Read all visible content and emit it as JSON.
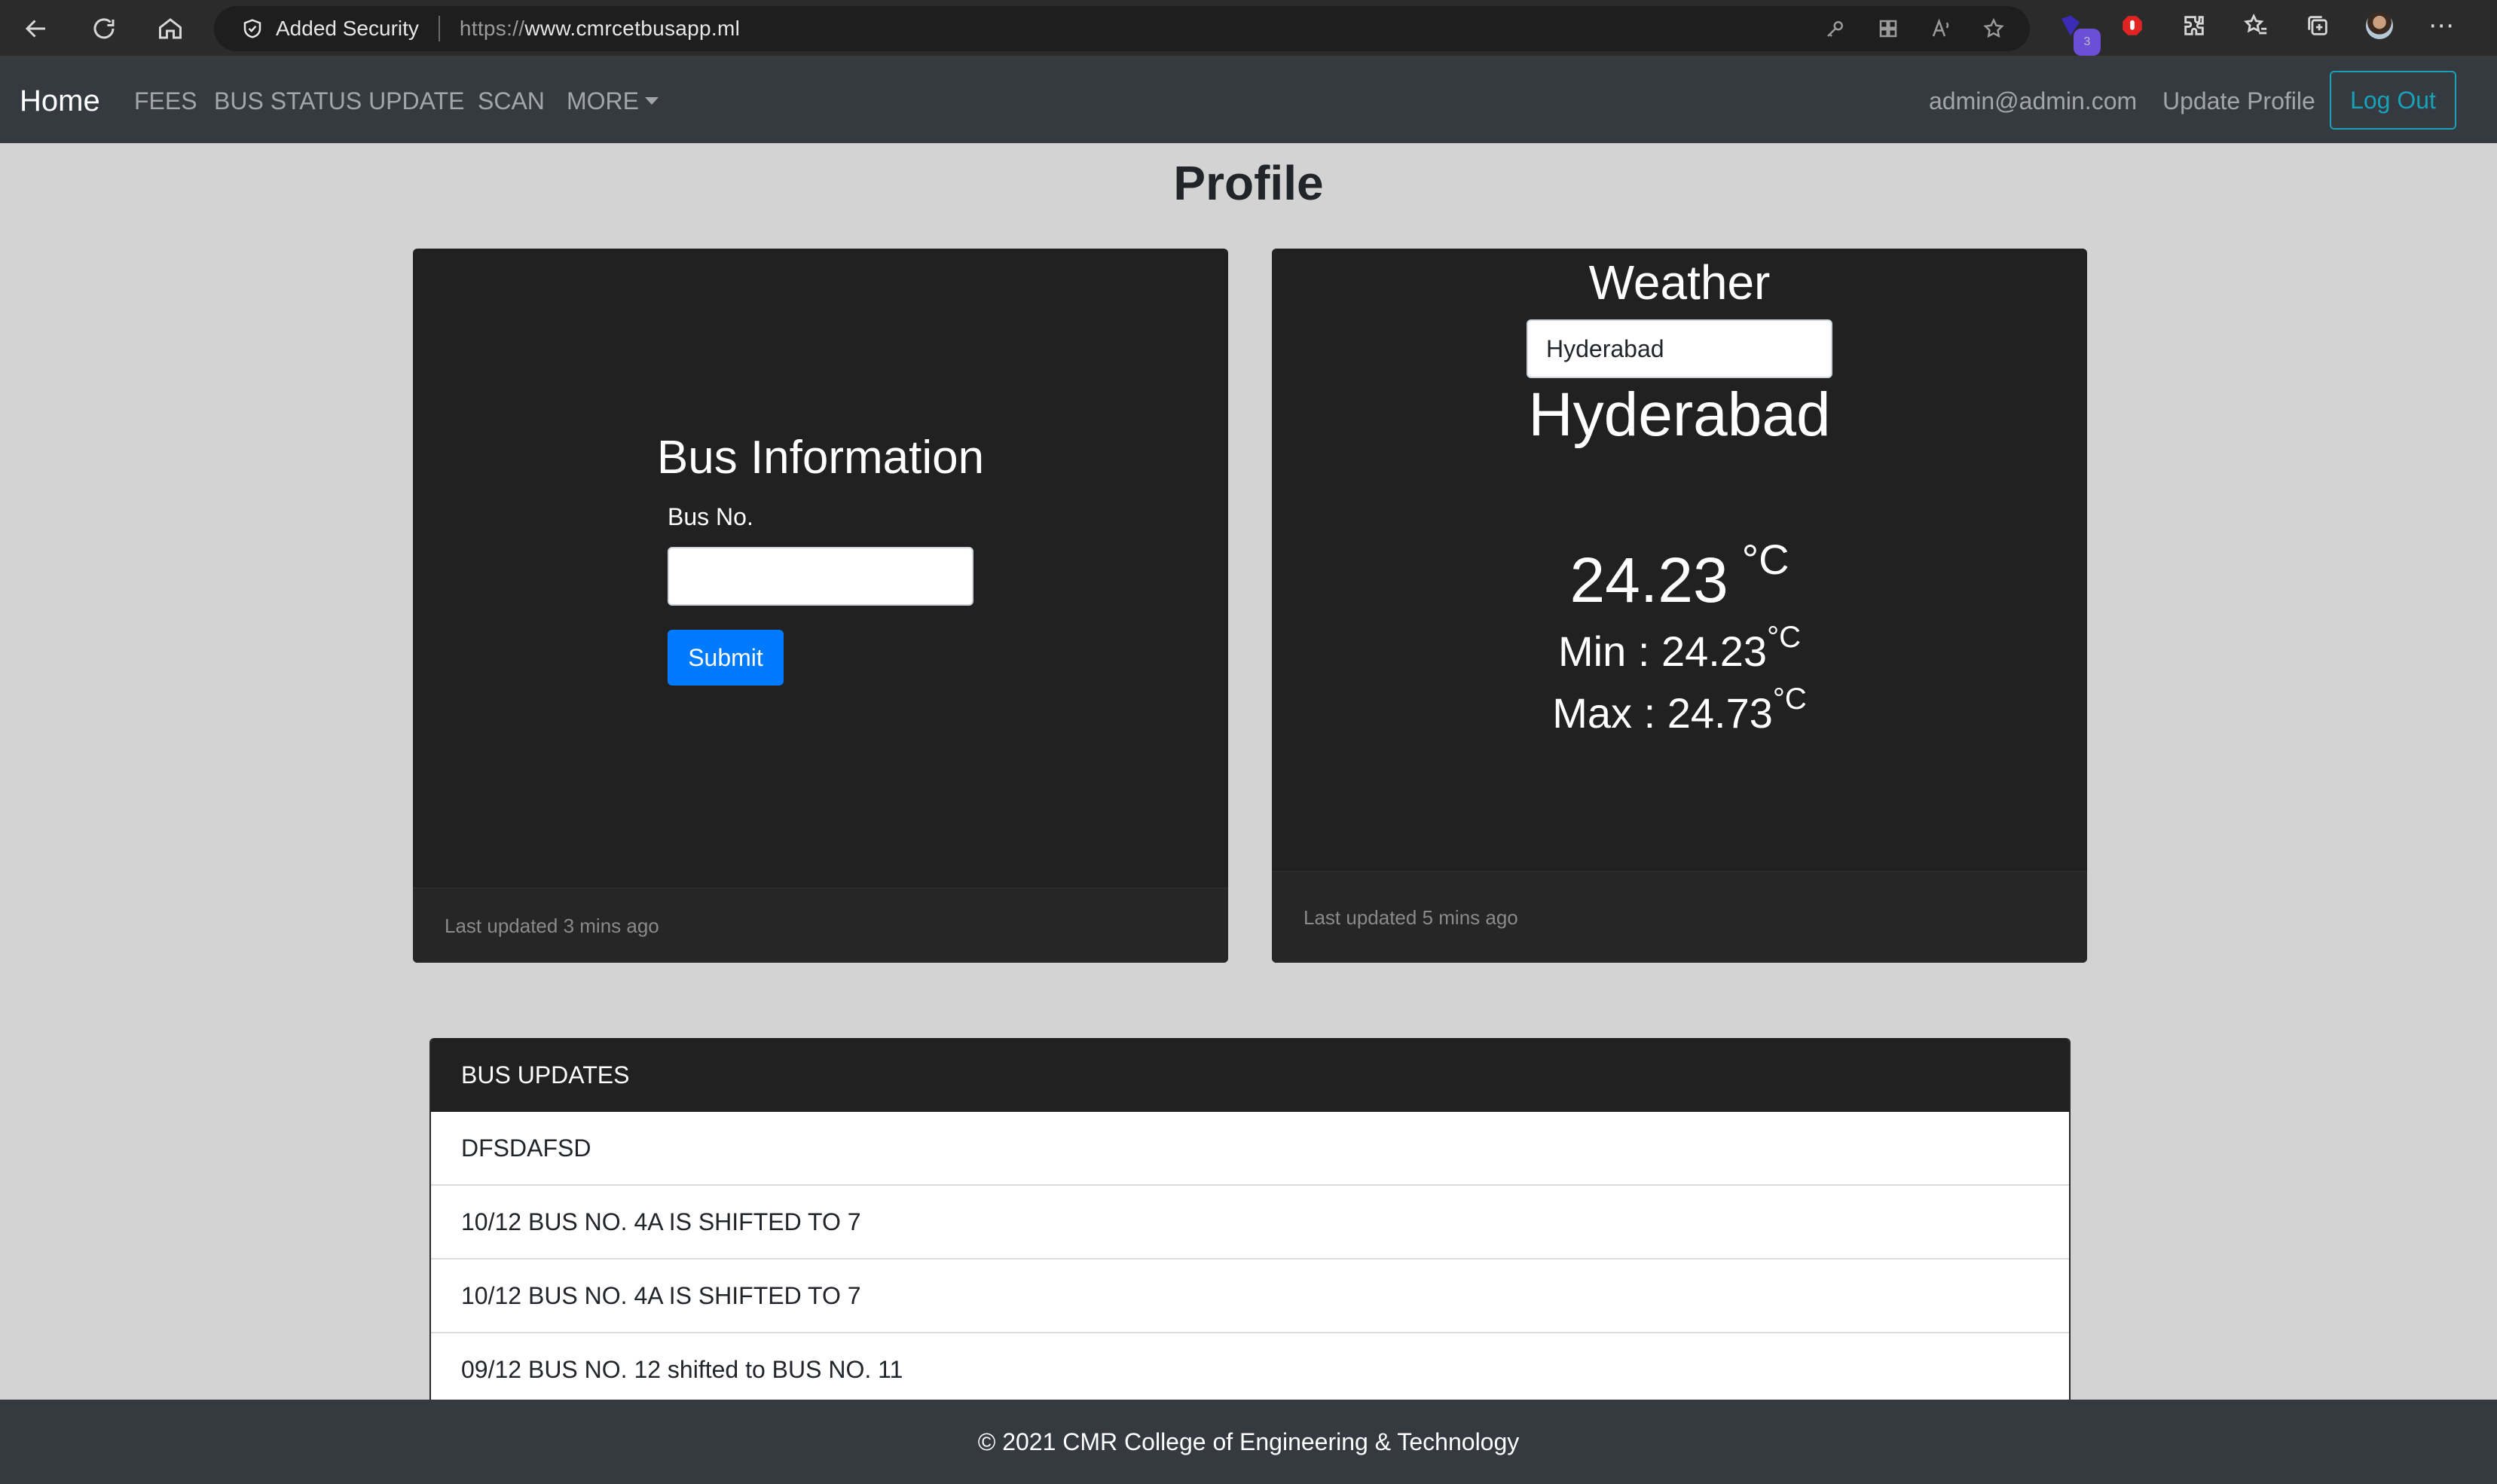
{
  "browser": {
    "security_label": "Added Security",
    "url_scheme": "https://",
    "url_host": "www.cmrcetbusapp.ml",
    "extension_badge": "3"
  },
  "navbar": {
    "brand": "Home",
    "links": [
      "FEES",
      "BUS STATUS UPDATE",
      "SCAN",
      "MORE"
    ],
    "user_email": "admin@admin.com",
    "update_profile": "Update Profile",
    "logout": "Log Out"
  },
  "page": {
    "title": "Profile"
  },
  "bus_card": {
    "title": "Bus Information",
    "field_label": "Bus No.",
    "bus_no_value": "",
    "submit_label": "Submit",
    "footer": "Last updated 3 mins ago"
  },
  "weather_card": {
    "title": "Weather",
    "city_input_value": "Hyderabad",
    "city_name": "Hyderabad",
    "temp": "24.23",
    "unit": "°C",
    "min_text": "Min : 24.23",
    "max_text": "Max : 24.73",
    "footer": "Last updated 5 mins ago"
  },
  "updates": {
    "header": "BUS UPDATES",
    "items": [
      "DFSDAFSD",
      "10/12 BUS NO. 4A IS SHIFTED TO 7",
      "10/12 BUS NO. 4A IS SHIFTED TO 7",
      "09/12 BUS NO. 12 shifted to BUS NO. 11"
    ]
  },
  "footer": {
    "text": "© 2021 CMR College of Engineering & Technology"
  }
}
